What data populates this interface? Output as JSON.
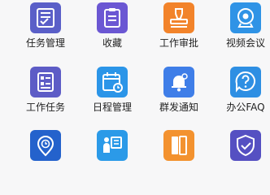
{
  "apps": [
    {
      "label": "任务管理",
      "icon": "task-list-icon",
      "color": "#5a5fc8"
    },
    {
      "label": "收藏",
      "icon": "clipboard-icon",
      "color": "#6b57d3"
    },
    {
      "label": "工作审批",
      "icon": "approval-stamp-icon",
      "color": "#f2832a"
    },
    {
      "label": "视频会议",
      "icon": "webcam-icon",
      "color": "#2f93e6"
    },
    {
      "label": "工作任务",
      "icon": "task-form-icon",
      "color": "#5d5cc6"
    },
    {
      "label": "日程管理",
      "icon": "calendar-icon",
      "color": "#2b95e8"
    },
    {
      "label": "群发通知",
      "icon": "bell-icon",
      "color": "#3f7ee8"
    },
    {
      "label": "办公FAQ",
      "icon": "question-icon",
      "color": "#2e8fe3"
    },
    {
      "label": "",
      "icon": "location-clock-icon",
      "color": "#2462cc"
    },
    {
      "label": "",
      "icon": "presentation-icon",
      "color": "#2b9ae8"
    },
    {
      "label": "",
      "icon": "document-icon",
      "color": "#f3922f"
    },
    {
      "label": "",
      "icon": "shield-check-icon",
      "color": "#5550c2"
    }
  ]
}
